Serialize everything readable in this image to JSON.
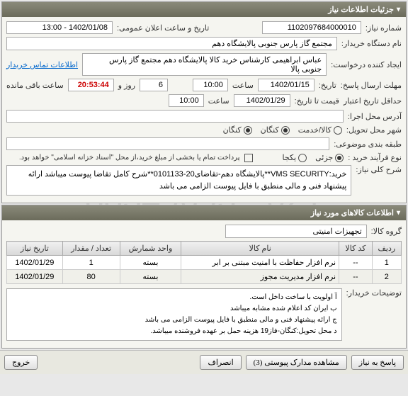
{
  "panel1": {
    "title": "جزئیات اطلاعات نیاز",
    "need_no_label": "شماره نیاز:",
    "need_no": "1102097684000010",
    "announce_label": "تاریخ و ساعت اعلان عمومی:",
    "announce_value": "1402/01/08 - 13:00",
    "buyer_label": "نام دستگاه خریدار:",
    "buyer_value": "مجتمع گاز پارس جنوبی پالایشگاه دهم",
    "requester_label": "ایجاد کننده درخواست:",
    "requester_value": "عباس ابراهیمی کارشناس خرید کالا پالایشگاه دهم مجتمع گاز پارس جنوبی پالا",
    "contact_link": "اطلاعات تماس خریدار",
    "deadline_label": "مهلت ارسال پاسخ:",
    "deadline_label2": "تاریخ:",
    "deadline_date": "1402/01/15",
    "deadline_time_label": "ساعت",
    "deadline_time": "10:00",
    "remain_days": "6",
    "remain_days_label": "روز و",
    "remain_time": "20:53:44",
    "remain_suffix": "ساعت باقی مانده",
    "validity_label": "حداقل تاریخ اعتبار",
    "validity_label2": "قیمت تا تاریخ:",
    "validity_date": "1402/01/29",
    "validity_time_label": "ساعت",
    "validity_time": "10:00",
    "exec_addr_label": "آدرس محل اجرا:",
    "delivery_city_label": "شهر محل تحویل:",
    "radio_service": "کالا/خدمت",
    "city_kangan": "کنگان",
    "city_kangan2": "کنگان",
    "category_label": "طبقه بندی موضوعی:",
    "buy_type_label": "نوع فرآیند خرید :",
    "radio_partial": "جزئی",
    "radio_total": "یکجا",
    "payment_note": "پرداخت تمام یا بخشی از مبلغ خرید،از محل \"اسناد خزانه اسلامی\" خواهد بود.",
    "desc_label": "شرح کلی نیاز:",
    "desc_text": "خرید:VMS SECURITY**پالایشگاه دهم-تقاضای20-0101133**شرح کامل تقاضا پیوست میباشد ارائه پیشنهاد فنی و مالی منطبق با فایل پیوست الزامی می باشد"
  },
  "panel2": {
    "title": "اطلاعات کالاهای مورد نیاز",
    "group_label": "گروه کالا:",
    "group_value": "تجهیزات امنیتی",
    "headers": {
      "row": "ردیف",
      "code": "کد کالا",
      "name": "نام کالا",
      "unit": "واحد شمارش",
      "qty": "تعداد / مقدار",
      "date": "تاریخ نیاز"
    },
    "rows": [
      {
        "idx": "1",
        "code": "--",
        "name": "نرم افزار حفاظت با امنیت مبتنی بر ابر",
        "unit": "بسته",
        "qty": "1",
        "date": "1402/01/29"
      },
      {
        "idx": "2",
        "code": "--",
        "name": "نرم افزار مدیریت مجوز",
        "unit": "بسته",
        "qty": "80",
        "date": "1402/01/29"
      }
    ],
    "notes_label": "توضیحات خریدار:",
    "notes": [
      "آ اولویت با ساخت داخل است.",
      "ب ایران کد اعلام شده مشابه میباشد",
      "ج ارائه پیشنهاد فنی و مالی منطبق با فایل پیوست الزامی می باشد",
      "د محل تحویل:کنگان-فاز19 هزینه حمل بر عهده فروشنده میباشد."
    ]
  },
  "footer": {
    "btn_reply": "پاسخ به نیاز",
    "btn_attach": "مشاهده مدارک پیوستی (3)",
    "btn_decline": "انصراف",
    "btn_exit": "خروج"
  }
}
